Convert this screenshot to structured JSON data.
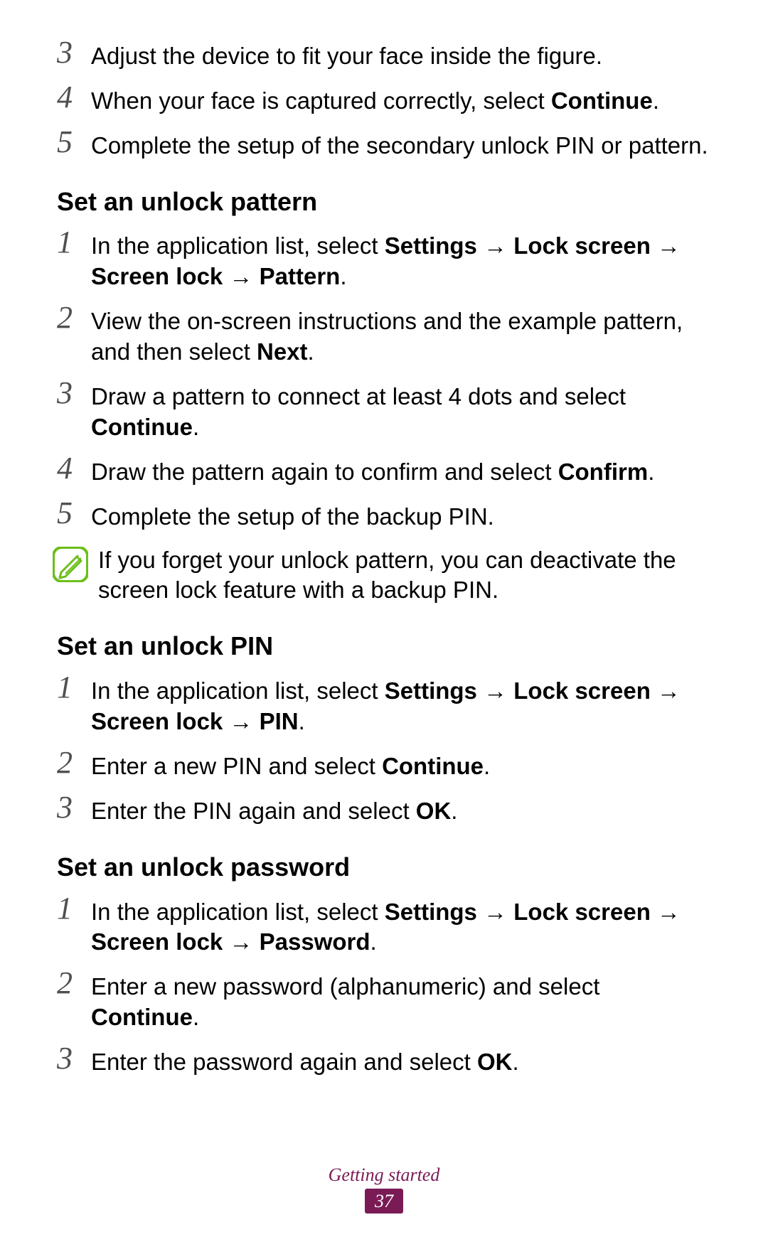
{
  "section_a": {
    "steps": [
      {
        "num": "3",
        "html": "Adjust the device to fit your face inside the figure."
      },
      {
        "num": "4",
        "html": "When your face is captured correctly, select <b>Continue</b>."
      },
      {
        "num": "5",
        "html": "Complete the setup of the secondary unlock PIN or pattern."
      }
    ]
  },
  "section_b": {
    "heading": "Set an unlock pattern",
    "steps": [
      {
        "num": "1",
        "html": "In the application list, select <b>Settings</b> → <b>Lock screen</b> → <b>Screen lock</b> → <b>Pattern</b>."
      },
      {
        "num": "2",
        "html": "View the on-screen instructions and the example pattern, and then select <b>Next</b>."
      },
      {
        "num": "3",
        "html": "Draw a pattern to connect at least 4 dots and select <b>Continue</b>."
      },
      {
        "num": "4",
        "html": "Draw the pattern again to confirm and select <b>Confirm</b>."
      },
      {
        "num": "5",
        "html": "Complete the setup of the backup PIN."
      }
    ],
    "note": "If you forget your unlock pattern, you can deactivate the screen lock feature with a backup PIN."
  },
  "section_c": {
    "heading": "Set an unlock PIN",
    "steps": [
      {
        "num": "1",
        "html": "In the application list, select <b>Settings</b> → <b>Lock screen</b> → <b>Screen lock</b> → <b>PIN</b>."
      },
      {
        "num": "2",
        "html": "Enter a new PIN and select <b>Continue</b>."
      },
      {
        "num": "3",
        "html": "Enter the PIN again and select <b>OK</b>."
      }
    ]
  },
  "section_d": {
    "heading": "Set an unlock password",
    "steps": [
      {
        "num": "1",
        "html": "In the application list, select <b>Settings</b> → <b>Lock screen</b> → <b>Screen lock</b> → <b>Password</b>."
      },
      {
        "num": "2",
        "html": "Enter a new password (alphanumeric) and select <b>Continue</b>."
      },
      {
        "num": "3",
        "html": "Enter the password again and select <b>OK</b>."
      }
    ]
  },
  "footer": {
    "chapter": "Getting started",
    "page": "37"
  }
}
